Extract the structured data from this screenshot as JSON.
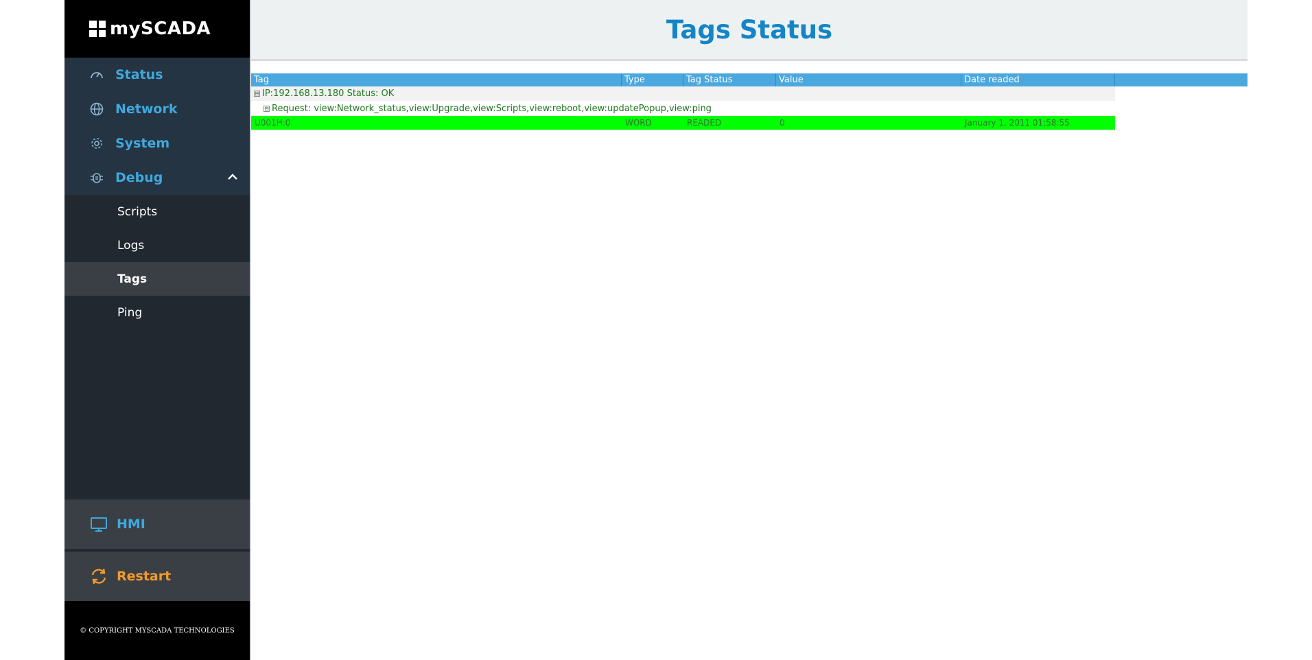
{
  "brand": {
    "name": "mySCADA"
  },
  "sidebar": {
    "items": [
      {
        "label": "Status",
        "icon": "gauge-icon"
      },
      {
        "label": "Network",
        "icon": "globe-icon"
      },
      {
        "label": "System",
        "icon": "gear-icon"
      },
      {
        "label": "Debug",
        "icon": "bug-icon"
      }
    ],
    "debug_sub": [
      {
        "label": "Scripts"
      },
      {
        "label": "Logs"
      },
      {
        "label": "Tags",
        "active": true
      },
      {
        "label": "Ping"
      }
    ],
    "hmi": {
      "label": "HMI",
      "icon": "monitor-icon"
    },
    "restart": {
      "label": "Restart",
      "icon": "refresh-icon"
    },
    "footer": "© COPYRIGHT MYSCADA TECHNOLOGIES"
  },
  "header": {
    "title": "Tags Status"
  },
  "table": {
    "columns": [
      "Tag",
      "Type",
      "Tag Status",
      "Value",
      "Date readed",
      ""
    ],
    "group": {
      "label": "IP:192.168.13.180 Status: OK",
      "toggle": "⊟"
    },
    "request": {
      "label": "Request: view:Network_status,view:Upgrade,view:Scripts,view:reboot,view:updatePopup,view:ping",
      "toggle": "⊟"
    },
    "rows": [
      {
        "tag": "U001H:0",
        "type": "WORD",
        "status": "READED",
        "value": "0",
        "date": "January 1, 2011 01:58:55"
      }
    ]
  },
  "colors": {
    "accent": "#1485c6",
    "nav_text": "#3fa9dd",
    "restart": "#f39a2b",
    "row_ok": "#00ff00",
    "table_header": "#4aa8de"
  }
}
